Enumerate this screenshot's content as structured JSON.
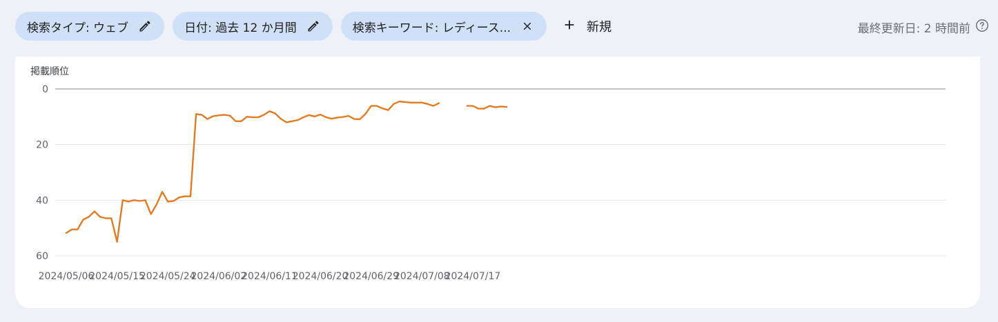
{
  "filters": {
    "search_type": "検索タイプ: ウェブ",
    "date": "日付: 過去 12 か月間",
    "query": "検索キーワード: レディース...",
    "new_label": "新規"
  },
  "header": {
    "last_updated": "最終更新日: 2 時間前"
  },
  "icons": {
    "edit": "pencil-icon",
    "close": "close-icon",
    "add": "plus-icon",
    "help": "help-circle-icon"
  },
  "colors": {
    "line": "#e37b23",
    "chip": "#cfe0f7",
    "background": "#eef2f8"
  },
  "chart_data": {
    "type": "line",
    "ylabel": "掲載順位",
    "ylim": [
      60,
      0
    ],
    "yticks": [
      0,
      20,
      40,
      60
    ],
    "inverted_y": true,
    "grid": true,
    "start_date": "2024/05/06",
    "xticks": [
      "2024/05/06",
      "2024/05/15",
      "2024/05/24",
      "2024/06/02",
      "2024/06/11",
      "2024/06/20",
      "2024/06/29",
      "2024/07/08",
      "2024/07/17"
    ],
    "series": [
      {
        "values": [
          51.8,
          50.5,
          50.5,
          47.0,
          46.0,
          44.0,
          46.0,
          46.5,
          46.5,
          55.0,
          40.0,
          40.5,
          40.0,
          40.3,
          40.0,
          45.0,
          41.5,
          37.0,
          40.5,
          40.3,
          39.0,
          38.6,
          38.6,
          9.0,
          9.3,
          10.8,
          9.8,
          9.5,
          9.3,
          9.6,
          11.6,
          11.6,
          10.0,
          10.2,
          10.2,
          9.3,
          8.0,
          8.8,
          10.7,
          12.0,
          11.6,
          11.2,
          10.2,
          9.4,
          9.9,
          9.2,
          10.2,
          10.7,
          10.3,
          10.1,
          9.7,
          10.8,
          10.9,
          9.0,
          6.1,
          6.1,
          7.0,
          7.6,
          5.4,
          4.5,
          4.7,
          4.9,
          4.9,
          4.9,
          5.4,
          6.1,
          5.1,
          null,
          null,
          null,
          null,
          6.1,
          6.1,
          7.1,
          7.1,
          6.1,
          6.6,
          6.3,
          6.5
        ]
      }
    ]
  }
}
